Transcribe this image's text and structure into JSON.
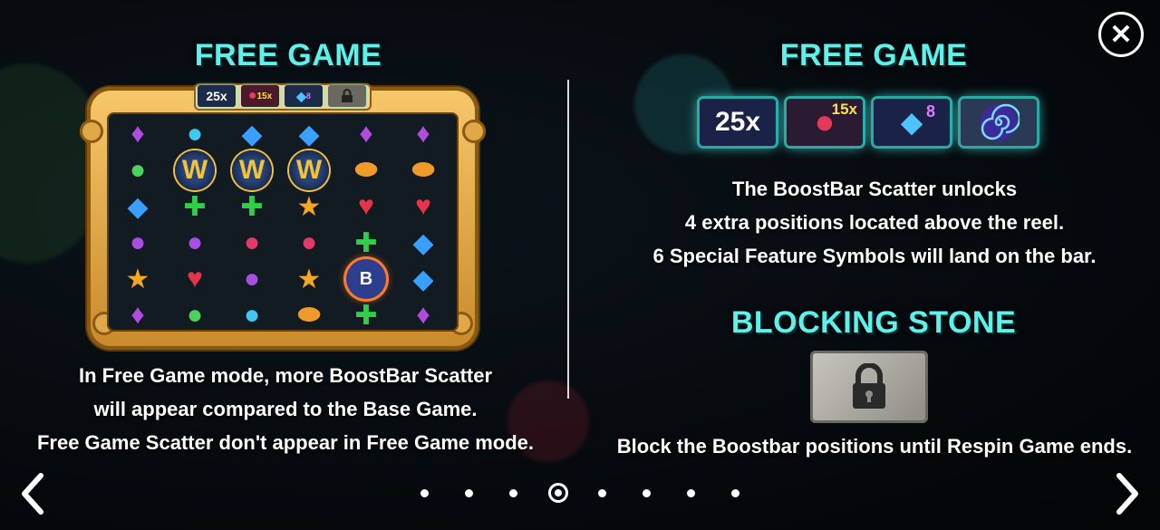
{
  "left_panel": {
    "title": "FREE GAME",
    "boostbar": {
      "multiplier": "25x",
      "coin_multiplier": "15x",
      "gem_count": "8"
    },
    "reel_icons": [
      [
        "purple-gem-icon",
        "blue-alien-icon",
        "blue-diamond-icon",
        "blue-diamond-icon",
        "purple-gem-icon",
        "purple-gem-icon"
      ],
      [
        "green-alien-icon",
        "wild-icon",
        "wild-icon",
        "wild-icon",
        "ufo-icon",
        "ufo-icon"
      ],
      [
        "blue-diamond-icon",
        "green-cross-icon",
        "green-cross-icon",
        "orange-star-icon",
        "red-heart-icon",
        "red-heart-icon"
      ],
      [
        "purple-alien-icon",
        "purple-alien-icon",
        "red-planet-icon",
        "red-planet-icon",
        "green-cross-icon",
        "blue-diamond-icon"
      ],
      [
        "orange-star-icon",
        "red-heart-icon",
        "purple-alien-icon",
        "orange-star-icon",
        "boostbar-scatter-icon",
        "blue-diamond-icon"
      ],
      [
        "purple-gem-icon",
        "green-alien-icon",
        "blue-alien-icon",
        "ufo-icon",
        "green-cross-icon",
        "purple-gem-icon"
      ]
    ],
    "description_lines": [
      "In Free Game mode, more BoostBar Scatter",
      "will appear compared to the Base Game.",
      "Free Game Scatter don't appear in Free Game mode."
    ]
  },
  "right_panel": {
    "title": "FREE GAME",
    "boostbar": {
      "multiplier": "25x",
      "coin_multiplier": "15x",
      "gem_count": "8"
    },
    "description_lines": [
      "The BoostBar Scatter unlocks",
      "4 extra positions located above the reel.",
      "6 Special Feature Symbols will land on the bar."
    ],
    "blocking_title": "BLOCKING STONE",
    "blocking_text": "Block the Boostbar positions until Respin Game ends."
  },
  "navigation": {
    "page_count": 8,
    "current_page": 4,
    "close_icon": "close-icon",
    "prev_icon": "chevron-left-icon",
    "next_icon": "chevron-right-icon"
  },
  "colors": {
    "title": "#5ff0ea",
    "text": "#ffffff",
    "frame": "#e2a848"
  }
}
